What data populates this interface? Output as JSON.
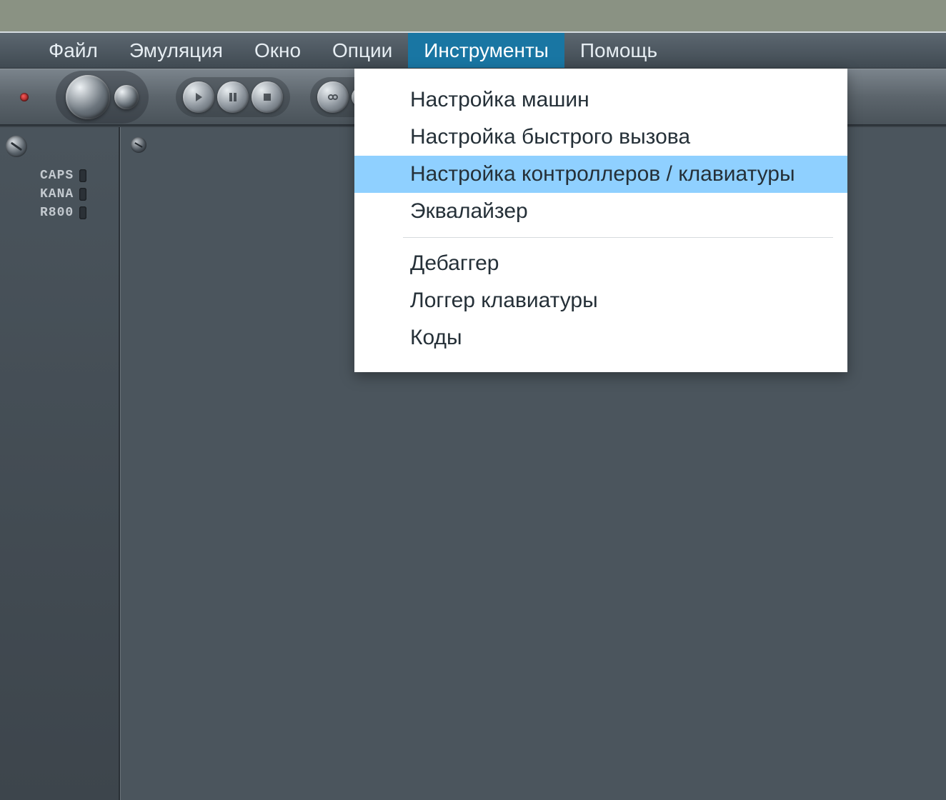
{
  "menubar": {
    "items": [
      {
        "label": "Файл",
        "active": false
      },
      {
        "label": "Эмуляция",
        "active": false
      },
      {
        "label": "Окно",
        "active": false
      },
      {
        "label": "Опции",
        "active": false
      },
      {
        "label": "Инструменты",
        "active": true
      },
      {
        "label": "Помощь",
        "active": false
      }
    ]
  },
  "toolbar": {
    "icons": {
      "play": "play-icon",
      "pause": "pause-icon",
      "stop": "stop-icon",
      "link": "link-icon",
      "step": "step-icon"
    }
  },
  "sidebar": {
    "indicators": [
      {
        "label": "CAPS"
      },
      {
        "label": "KANA"
      },
      {
        "label": "R800"
      }
    ]
  },
  "dropdown": {
    "group1": [
      {
        "label": "Настройка машин",
        "highlight": false
      },
      {
        "label": "Настройка быстрого вызова",
        "highlight": false
      },
      {
        "label": "Настройка контроллеров / клавиатуры",
        "highlight": true
      },
      {
        "label": "Эквалайзер",
        "highlight": false
      }
    ],
    "group2": [
      {
        "label": "Дебаггер",
        "highlight": false
      },
      {
        "label": "Логгер клавиатуры",
        "highlight": false
      },
      {
        "label": "Коды",
        "highlight": false
      }
    ]
  }
}
